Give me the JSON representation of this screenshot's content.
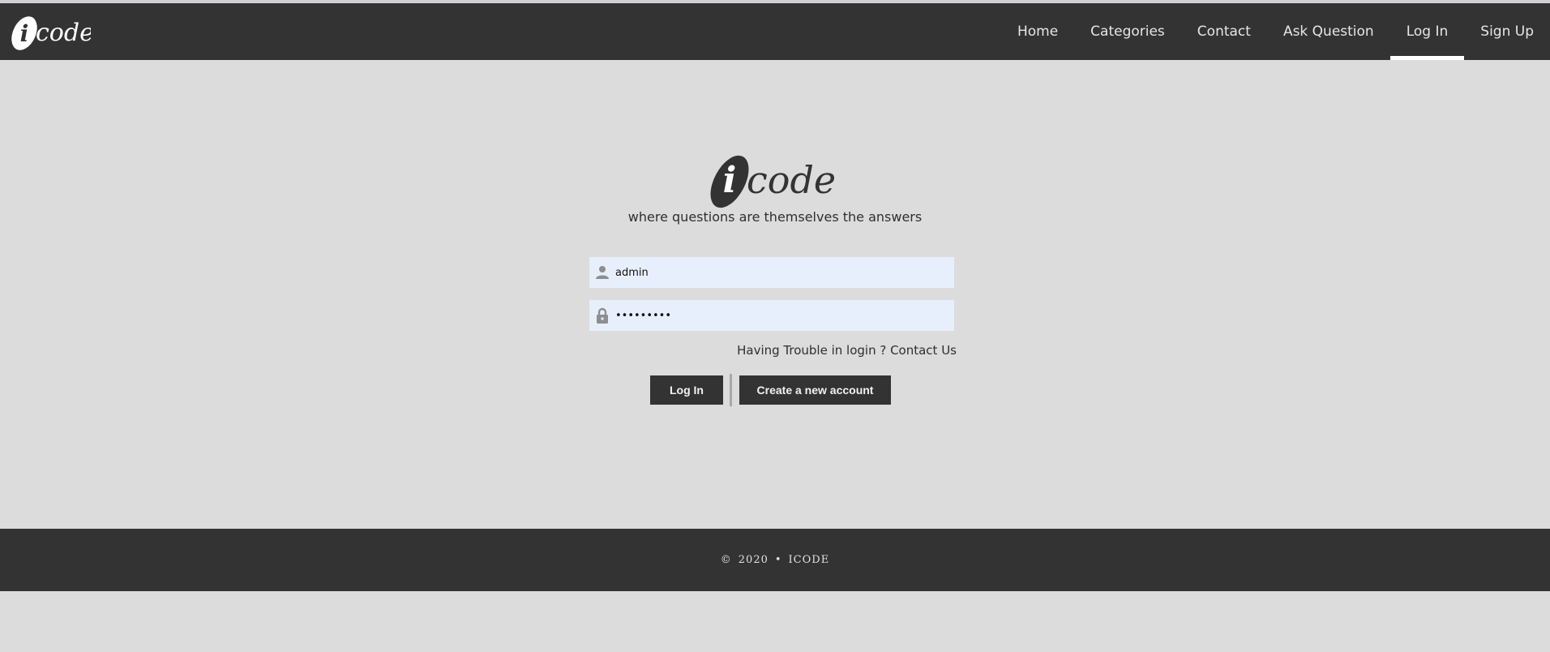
{
  "brand": {
    "logo_letter": "i",
    "logo_word": "code"
  },
  "nav": {
    "items": [
      {
        "label": "Home"
      },
      {
        "label": "Categories"
      },
      {
        "label": "Contact"
      },
      {
        "label": "Ask Question"
      },
      {
        "label": "Log In",
        "active": true
      },
      {
        "label": "Sign Up"
      }
    ]
  },
  "hero": {
    "logo_letter": "i",
    "logo_word": "code",
    "tagline": "where questions are themselves the answers"
  },
  "form": {
    "username": {
      "value": "admin",
      "icon": "user-icon"
    },
    "password": {
      "value": "•••••••••",
      "icon": "lock-icon"
    },
    "trouble_link": "Having Trouble in login ? Contact Us",
    "login_button": "Log In",
    "create_button": "Create a new account"
  },
  "footer": {
    "copyright_symbol": "©",
    "year": "2020",
    "separator": "•",
    "brand": "ICODE"
  },
  "colors": {
    "nav_bg": "#333333",
    "page_bg": "#dcdcdc",
    "input_bg": "#e8effc",
    "button_bg": "#333333"
  }
}
